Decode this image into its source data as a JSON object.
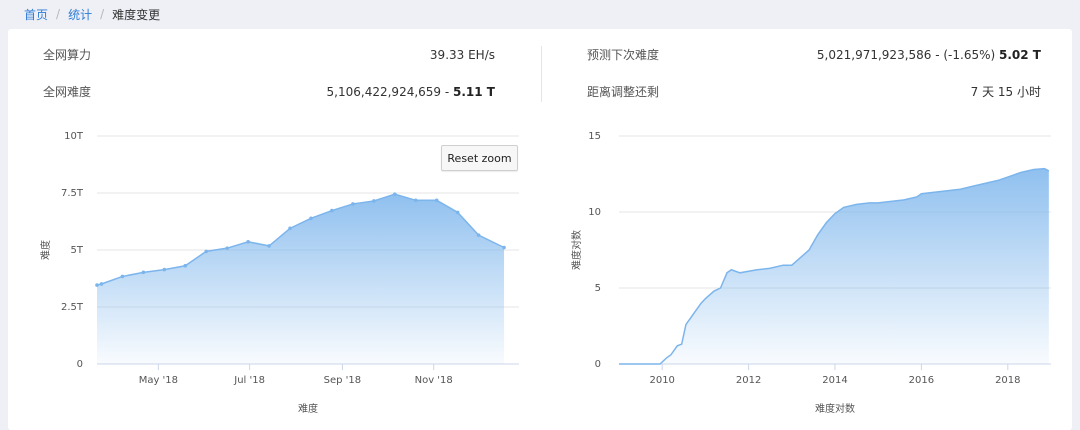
{
  "breadcrumb": {
    "home": "首页",
    "stats": "统计",
    "current": "难度变更"
  },
  "stats": {
    "hashrate_label": "全网算力",
    "hashrate_value": "39.33 EH/s",
    "difficulty_label": "全网难度",
    "difficulty_raw": "5,106,422,924,659 - ",
    "difficulty_short": "5.11 T",
    "next_label": "预测下次难度",
    "next_raw": "5,021,971,923,586 - (-1.65%) ",
    "next_short": "5.02 T",
    "remaining_label": "距离调整还剩",
    "remaining_value": "7 天 15 小时"
  },
  "reset_zoom_label": "Reset zoom",
  "colors": {
    "line": "#7cb5ec",
    "area_top": "#7cb5ec",
    "grid": "#e6e6e6",
    "accent": "#2e7dd7"
  },
  "chart_data": [
    {
      "type": "area",
      "ylabel": "难度",
      "xlabel": "难度",
      "ylim": [
        0,
        10
      ],
      "y_unit": "T",
      "yticks": [
        0,
        2.5,
        5,
        7.5,
        10
      ],
      "ytick_labels": [
        "0",
        "2.5T",
        "5T",
        "7.5T",
        "10T"
      ],
      "xticks": [
        "2018-05-01",
        "2018-07-01",
        "2018-09-01",
        "2018-11-01"
      ],
      "xtick_labels": [
        "May '18",
        "Jul '18",
        "Sep '18",
        "Nov '18"
      ],
      "xlim": [
        "2018-03-21",
        "2018-12-28"
      ],
      "x": [
        "2018-03-21",
        "2018-03-24",
        "2018-04-07",
        "2018-04-21",
        "2018-05-05",
        "2018-05-19",
        "2018-06-02",
        "2018-06-16",
        "2018-06-30",
        "2018-07-14",
        "2018-07-28",
        "2018-08-11",
        "2018-08-25",
        "2018-09-08",
        "2018-09-22",
        "2018-10-06",
        "2018-10-20",
        "2018-11-03",
        "2018-11-17",
        "2018-12-01",
        "2018-12-18"
      ],
      "values": [
        3.46,
        3.51,
        3.84,
        4.02,
        4.14,
        4.31,
        4.94,
        5.08,
        5.36,
        5.18,
        5.95,
        6.39,
        6.73,
        7.02,
        7.15,
        7.45,
        7.18,
        7.18,
        6.65,
        5.65,
        5.11
      ],
      "series": [
        {
          "name": "",
          "values": []
        }
      ]
    },
    {
      "type": "area",
      "ylabel": "难度对数",
      "xlabel": "难度对数",
      "ylim": [
        0,
        15
      ],
      "yticks": [
        0,
        5,
        10,
        15
      ],
      "xticks": [
        2010,
        2012,
        2014,
        2016,
        2018
      ],
      "xlim": [
        2009.0,
        2019.0
      ],
      "x": [
        2009.0,
        2009.5,
        2009.95,
        2010.1,
        2010.2,
        2010.35,
        2010.45,
        2010.55,
        2010.65,
        2010.75,
        2010.9,
        2011.0,
        2011.2,
        2011.35,
        2011.5,
        2011.6,
        2011.8,
        2012.0,
        2012.2,
        2012.5,
        2012.8,
        2013.0,
        2013.2,
        2013.4,
        2013.6,
        2013.8,
        2014.0,
        2014.2,
        2014.5,
        2014.8,
        2015.0,
        2015.3,
        2015.6,
        2015.9,
        2016.0,
        2016.3,
        2016.6,
        2016.9,
        2017.2,
        2017.5,
        2017.8,
        2018.0,
        2018.3,
        2018.6,
        2018.85,
        2018.95
      ],
      "values": [
        0.0,
        0.0,
        0.0,
        0.4,
        0.6,
        1.2,
        1.3,
        2.6,
        3.0,
        3.4,
        4.0,
        4.3,
        4.8,
        5.0,
        6.0,
        6.2,
        6.0,
        6.1,
        6.2,
        6.3,
        6.5,
        6.5,
        7.0,
        7.5,
        8.5,
        9.3,
        9.9,
        10.3,
        10.5,
        10.6,
        10.6,
        10.7,
        10.8,
        11.0,
        11.2,
        11.3,
        11.4,
        11.5,
        11.7,
        11.9,
        12.1,
        12.3,
        12.6,
        12.8,
        12.85,
        12.7
      ]
    }
  ]
}
